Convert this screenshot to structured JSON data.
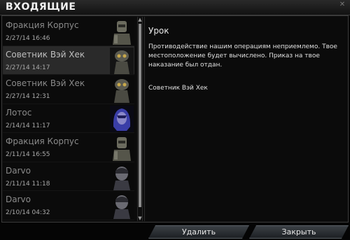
{
  "window": {
    "title": "ВХОДЯЩИЕ"
  },
  "inbox": {
    "messages": [
      {
        "sender": "Фракция Корпус",
        "date": "2/27/14 16:46",
        "portrait": "corpus-soldier-portrait",
        "selected": false
      },
      {
        "sender": "Советник Вэй Хек",
        "date": "2/27/14 14:17",
        "portrait": "vay-hek-portrait",
        "selected": true
      },
      {
        "sender": "Советник Вэй Хек",
        "date": "2/27/14 12:31",
        "portrait": "vay-hek-portrait",
        "selected": false
      },
      {
        "sender": "Лотос",
        "date": "2/14/14 11:17",
        "portrait": "lotus-portrait",
        "selected": false
      },
      {
        "sender": "Фракция Корпус",
        "date": "2/11/14 16:55",
        "portrait": "corpus-soldier-portrait",
        "selected": false
      },
      {
        "sender": "Darvo",
        "date": "2/11/14 11:18",
        "portrait": "darvo-portrait",
        "selected": false
      },
      {
        "sender": "Darvo",
        "date": "2/10/14 04:32",
        "portrait": "darvo-portrait",
        "selected": false
      }
    ]
  },
  "reader": {
    "subject": "Урок",
    "body": "Противодействие нашим операциям неприемлемо. Твое местоположение будет вычислено. Приказ на твое наказание был отдан.",
    "signature": "Советник Вэй Хек"
  },
  "buttons": {
    "delete_label": "Удалить",
    "close_label": "Закрыть"
  },
  "colors": {
    "selected_row": "#2a2a2a",
    "button_border": "#5a6066"
  }
}
